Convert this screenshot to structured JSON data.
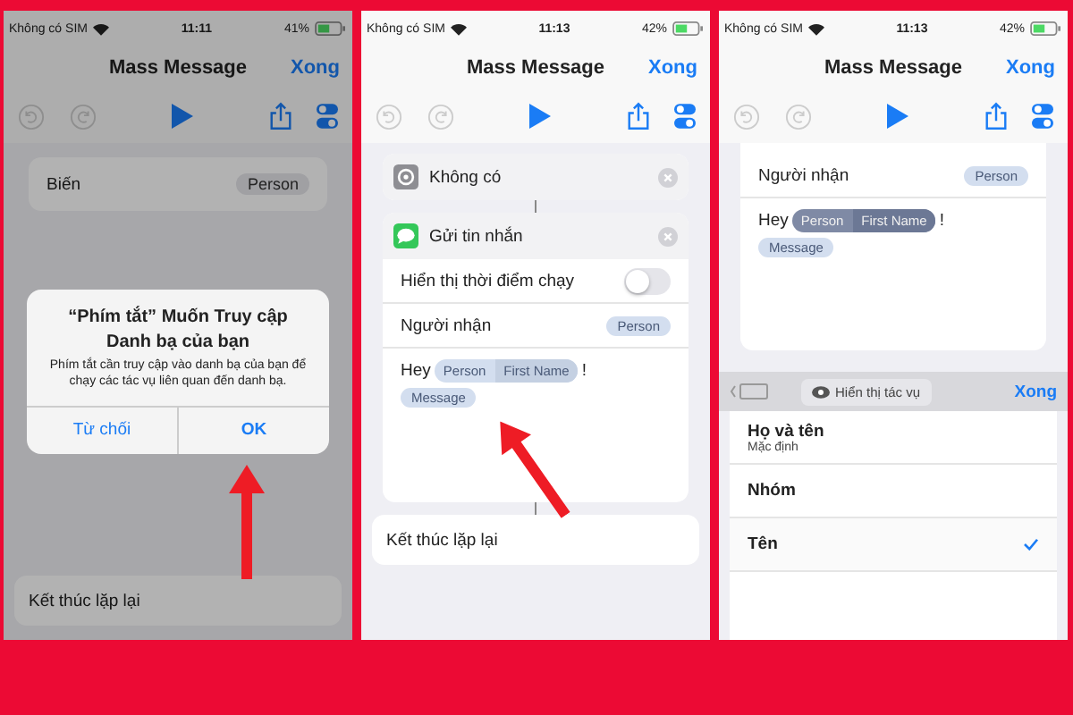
{
  "phones": [
    {
      "kind": "alert",
      "status_bar": {
        "carrier": "Không có SIM",
        "time": "11:11",
        "battery": "41%"
      },
      "title": "Mass Message",
      "done": "Xong",
      "variable": {
        "label": "Biến",
        "value": "Person"
      },
      "alert": {
        "title": "“Phím tắt” Muốn Truy cập Danh bạ của bạn",
        "message": "Phím tắt cần truy cập vào danh bạ của bạn để chạy các tác vụ liên quan đến danh bạ.",
        "buttons": [
          {
            "label": "Từ chối",
            "kind": "cancel"
          },
          {
            "label": "OK",
            "kind": "default"
          }
        ]
      },
      "footer": "Kết thúc lặp lại"
    },
    {
      "kind": "editor",
      "status_bar": {
        "carrier": "Không có SIM",
        "time": "11:13",
        "battery": "42%"
      },
      "title": "Mass Message",
      "done": "Xong",
      "actions": [
        {
          "kind": "settings",
          "title": "Không có"
        },
        {
          "kind": "message",
          "title": "Gửi tin nhắn"
        }
      ],
      "show_at_run": {
        "label": "Hiển thị thời điểm chạy",
        "on": false
      },
      "recipient": {
        "label": "Người nhận",
        "value": "Person"
      },
      "message": {
        "text": "Hey",
        "variable": "Person",
        "property": "First Name",
        "highlighted": false,
        "after": "!",
        "second": "Message"
      },
      "footer": "Kết thúc lặp lại"
    },
    {
      "kind": "picker",
      "status_bar": {
        "carrier": "Không có SIM",
        "time": "11:13",
        "battery": "42%"
      },
      "title": "Mass Message",
      "done": "Xong",
      "recipient": {
        "label": "Người nhận",
        "value": "Person"
      },
      "message": {
        "text": "Hey",
        "variable": "Person",
        "property": "First Name",
        "highlighted": true,
        "after": "!",
        "second": "Message"
      },
      "accessory": {
        "label": "Hiển thị tác vụ",
        "done": "Xong"
      },
      "options": [
        {
          "label": "Họ và tên",
          "detail": "Mặc định",
          "selected": false
        },
        {
          "label": "Nhóm",
          "selected": false
        },
        {
          "label": "Tên",
          "selected": true
        }
      ]
    }
  ]
}
